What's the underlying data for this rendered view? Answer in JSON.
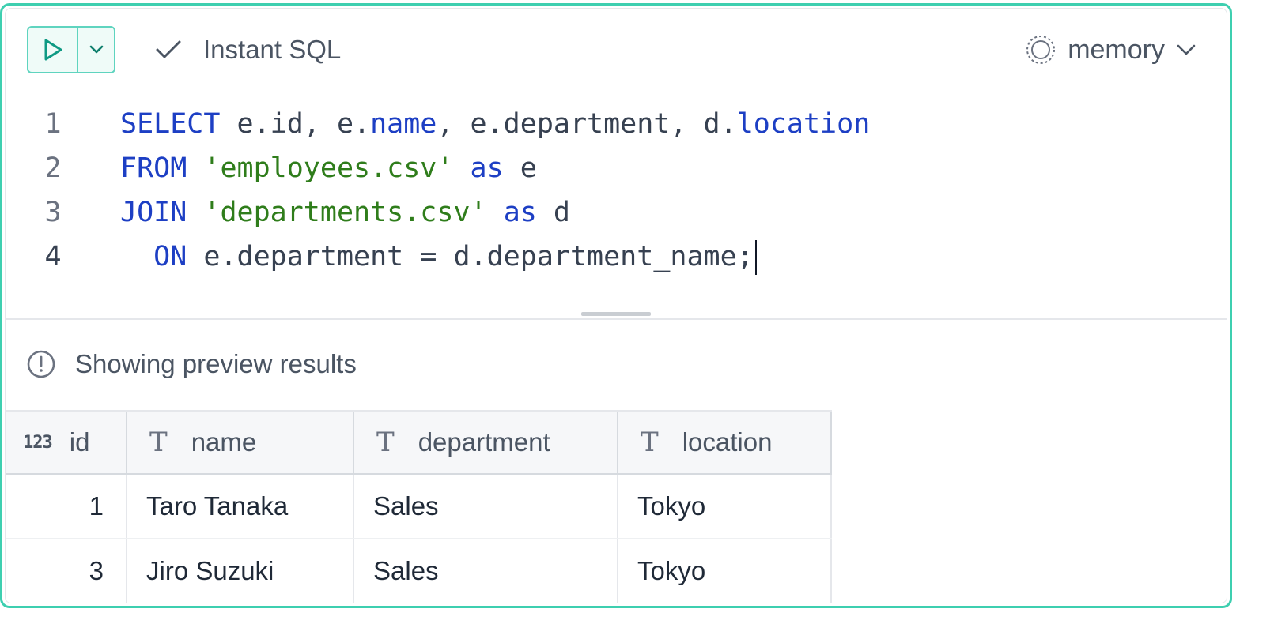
{
  "toolbar": {
    "run_icon": "play-icon",
    "dropdown_icon": "chevron-down-icon",
    "instant_icon": "check-icon",
    "instant_label": "Instant SQL",
    "db_icon": "database-spinner-icon",
    "db_label": "memory",
    "accent": "#3ecfb0"
  },
  "editor": {
    "lines": [
      {
        "number": "1",
        "segments": [
          {
            "t": "SELECT",
            "k": "kw"
          },
          {
            "t": " e.id, e.",
            "k": ""
          },
          {
            "t": "name",
            "k": "kw"
          },
          {
            "t": ", e.department, d.",
            "k": ""
          },
          {
            "t": "location",
            "k": "kw"
          }
        ]
      },
      {
        "number": "2",
        "segments": [
          {
            "t": "FROM",
            "k": "kw"
          },
          {
            "t": " ",
            "k": ""
          },
          {
            "t": "'employees.csv'",
            "k": "str"
          },
          {
            "t": " ",
            "k": ""
          },
          {
            "t": "as",
            "k": "kw"
          },
          {
            "t": " e",
            "k": ""
          }
        ]
      },
      {
        "number": "3",
        "segments": [
          {
            "t": "JOIN",
            "k": "kw"
          },
          {
            "t": " ",
            "k": ""
          },
          {
            "t": "'departments.csv'",
            "k": "str"
          },
          {
            "t": " ",
            "k": ""
          },
          {
            "t": "as",
            "k": "kw"
          },
          {
            "t": " d",
            "k": ""
          }
        ]
      },
      {
        "number": "4",
        "segments": [
          {
            "t": "  ",
            "k": ""
          },
          {
            "t": "ON",
            "k": "kw"
          },
          {
            "t": " e.department = d.department_name;",
            "k": ""
          }
        ]
      }
    ]
  },
  "results": {
    "notice_icon": "alert-circle-icon",
    "notice": "Showing preview results",
    "columns": [
      {
        "type_label": "123",
        "label": "id"
      },
      {
        "type_label": "T",
        "label": "name"
      },
      {
        "type_label": "T",
        "label": "department"
      },
      {
        "type_label": "T",
        "label": "location"
      }
    ],
    "rows": [
      {
        "id": "1",
        "name": "Taro Tanaka",
        "department": "Sales",
        "location": "Tokyo"
      },
      {
        "id": "3",
        "name": "Jiro Suzuki",
        "department": "Sales",
        "location": "Tokyo"
      }
    ]
  }
}
